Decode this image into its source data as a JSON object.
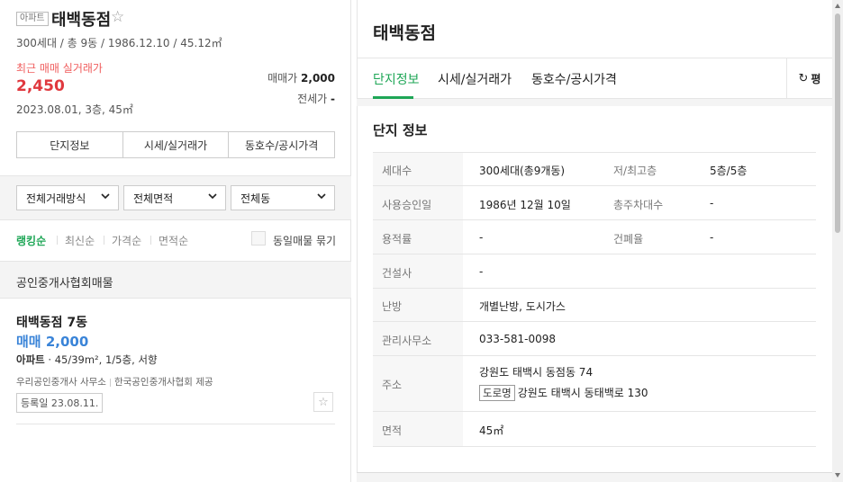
{
  "complex": {
    "type_badge": "아파트",
    "name": "태백동점",
    "star_icon": "star-outline-icon",
    "info": "300세대 / 총 9동 / 1986.12.10 / 45.12㎡"
  },
  "recent_trade": {
    "label": "최근 매매 실거래가",
    "price": "2,450",
    "date": "2023.08.01, 3층, 45㎡"
  },
  "listing_summary": {
    "sale_label": "매매가",
    "sale_value": "2,000",
    "rent_label": "전세가",
    "rent_value": "-"
  },
  "summary_tabs": [
    "단지정보",
    "시세/실거래가",
    "동호수/공시가격"
  ],
  "filters": [
    "전체거래방식",
    "전체면적",
    "전체동"
  ],
  "sort": {
    "options": [
      "랭킹순",
      "최신순",
      "가격순",
      "면적순"
    ],
    "active": "랭킹순",
    "group_label": "동일매물 묶기"
  },
  "association_title": "공인중개사협회매물",
  "listing": {
    "name": "태백동점 7동",
    "price": "매매 2,000",
    "type": "아파트",
    "spec": " · 45/39m², 1/5층, 서향",
    "agent": "우리공인중개사 사무소",
    "provider": "한국공인중개사협회 제공",
    "registered": "등록일 23.08.11."
  },
  "detail": {
    "title": "태백동점",
    "tabs": [
      "단지정보",
      "시세/실거래가",
      "동호수/공시가격"
    ],
    "active_tab": "단지정보",
    "unit_toggle": "평",
    "unit_icon": "refresh-icon",
    "section_title": "단지 정보",
    "rows": {
      "households_label": "세대수",
      "households": "300세대(총9개동)",
      "floors_label": "저/최고층",
      "floors": "5층/5층",
      "approval_label": "사용승인일",
      "approval": "1986년 12월 10일",
      "parking_label": "총주차대수",
      "parking": "-",
      "far_label": "용적률",
      "far": "-",
      "bcr_label": "건폐율",
      "bcr": "-",
      "builder_label": "건설사",
      "builder": "-",
      "heating_label": "난방",
      "heating": "개별난방, 도시가스",
      "office_label": "관리사무소",
      "office": "033-581-0098",
      "address_label": "주소",
      "address": "강원도 태백시 동점동 74",
      "road_tag": "도로명",
      "road_address": "강원도 태백시 동태백로 130",
      "area_label": "면적",
      "area": "45㎡"
    }
  }
}
